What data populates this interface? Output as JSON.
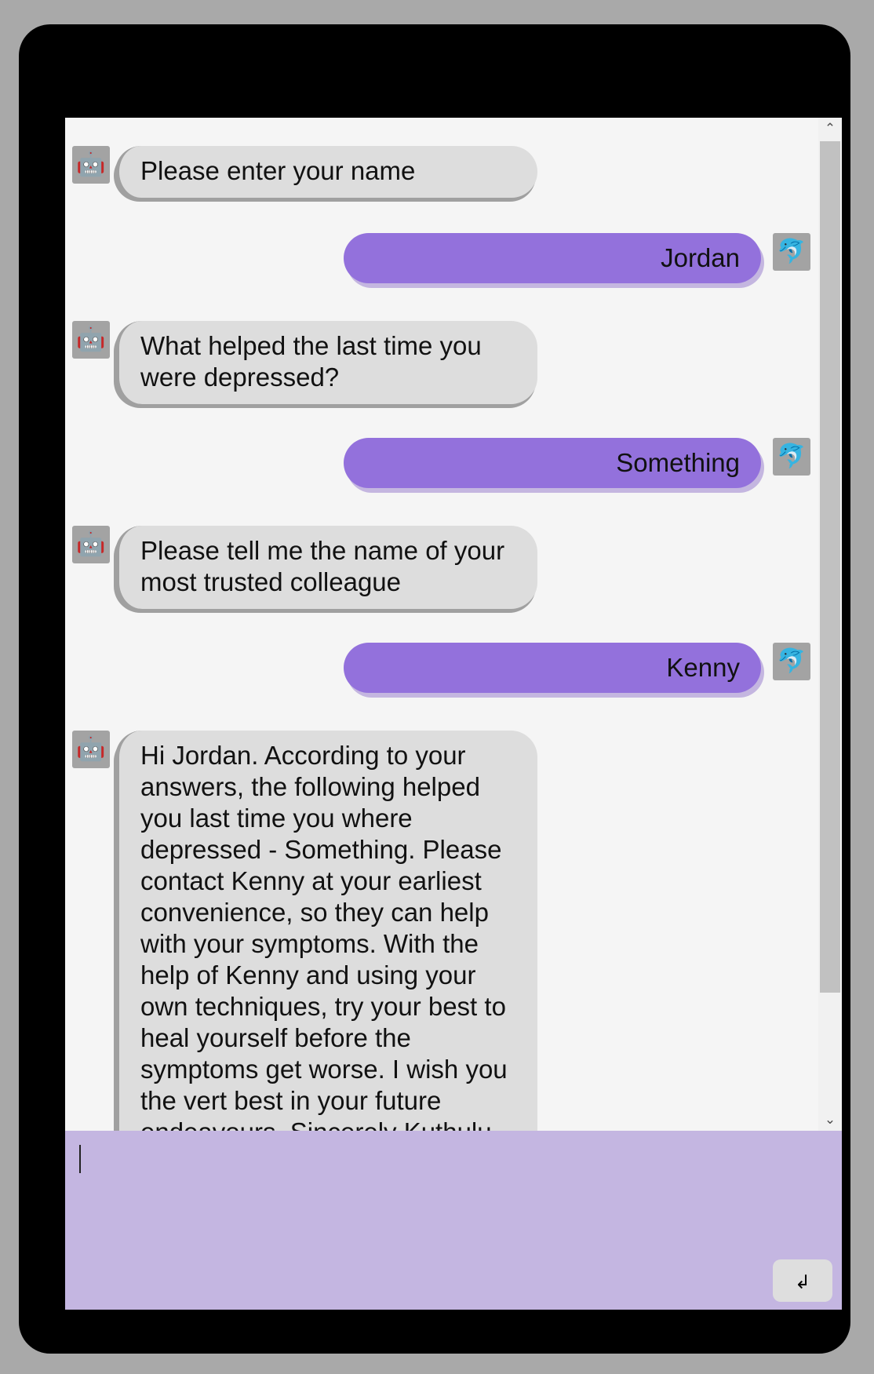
{
  "colors": {
    "bot_bubble": "#dddddd",
    "user_bubble": "#9371dc",
    "input_area": "#c4b6e1"
  },
  "icons": {
    "bot_avatar": "🤖",
    "user_avatar": "🐬",
    "scroll_up": "⌃",
    "scroll_down": "⌄",
    "send": "↲"
  },
  "messages": [
    {
      "sender": "bot",
      "text": "Please enter your name"
    },
    {
      "sender": "user",
      "text": "Jordan"
    },
    {
      "sender": "bot",
      "text": "What helped the last time you were depressed?"
    },
    {
      "sender": "user",
      "text": "Something"
    },
    {
      "sender": "bot",
      "text": "Please tell me the name of your most trusted colleague"
    },
    {
      "sender": "user",
      "text": "Kenny"
    },
    {
      "sender": "bot",
      "text": "Hi Jordan. According to your answers, the following helped you last time you where depressed - Something. Please contact Kenny at your earliest convenience, so they can help with your symptoms. With the help of Kenny and using your own techniques, try your best to heal yourself before the symptoms get worse. I wish you the vert best in your future endeavours. Sincerely Kuthulu"
    }
  ],
  "input": {
    "value": ""
  }
}
